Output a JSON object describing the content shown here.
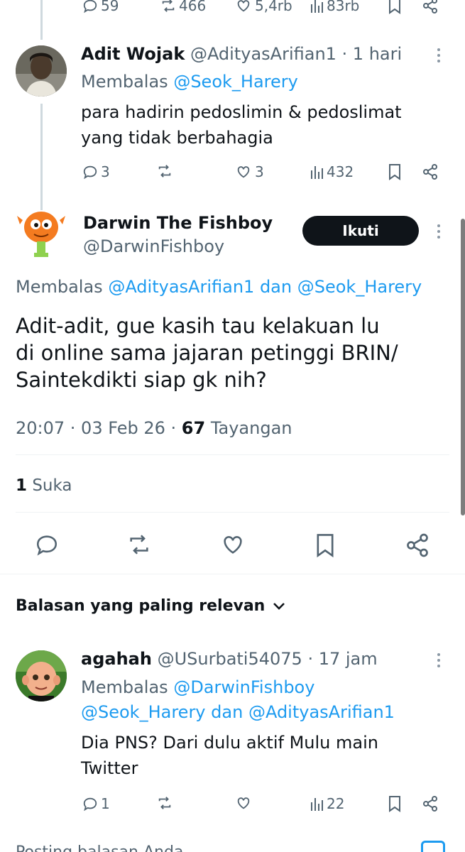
{
  "top_actions": {
    "replies": "59",
    "reposts": "466",
    "likes": "5,4rb",
    "views": "83rb"
  },
  "reply1": {
    "name": "Adit Wojak",
    "handle_time": "@AdityasArifian1 · 1 hari",
    "replying_prefix": "Membalas",
    "replying_to": "@Seok_Harery",
    "text_line1": "para hadirin pedoslimin & pedoslimat",
    "text_line2": "yang tidak berbahagia",
    "replies": "3",
    "likes": "3",
    "views": "432"
  },
  "main": {
    "name": "Darwin The Fishboy",
    "handle": "@DarwinFishboy",
    "follow_label": "Ikuti",
    "replying_prefix": "Membalas",
    "replying_to_1": "@AdityasArifian1",
    "replying_and": "dan",
    "replying_to_2": "@Seok_Harery",
    "text_line1": "Adit-adit, gue kasih tau kelakuan lu",
    "text_line2": "di online sama jajaran petinggi BRIN/",
    "text_line3": "Saintekdikti siap gk nih?",
    "timestamp": "20:07 · 03 Feb 26 · ",
    "view_count": "67",
    "view_label": "Tayangan",
    "like_count": "1",
    "like_label": "Suka"
  },
  "sort": {
    "label": "Balasan yang paling relevan"
  },
  "reply2": {
    "name": "agahah",
    "handle_time": "@USurbati54075 · 17 jam",
    "replying_prefix": "Membalas",
    "replying_to_1": "@DarwinFishboy",
    "replying_to_2": "@Seok_Harery",
    "replying_and": "dan",
    "replying_to_3": "@AdityasArifian1",
    "text_line1": "Dia PNS? Dari dulu aktif Mulu main",
    "text_line2": "Twitter",
    "replies": "1",
    "views": "22"
  },
  "bottom_partial": {
    "text": "Posting balasan Anda"
  },
  "colors": {
    "accent": "#1d9bf0",
    "muted": "#536471",
    "text": "#0f1419",
    "follow_bg": "#0f1419"
  }
}
